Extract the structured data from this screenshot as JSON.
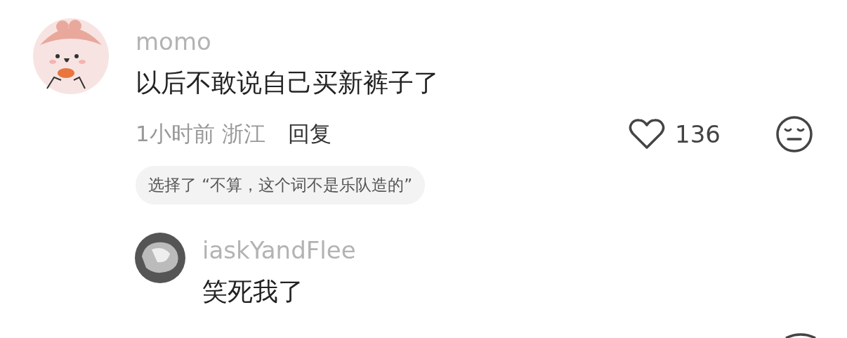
{
  "comment": {
    "username": "momo",
    "text": "以后不敢说自己买新裤子了",
    "time_location": "1小时前 浙江",
    "reply_label": "回复",
    "liked": false,
    "like_count": "136",
    "vote_tag": "选择了 “不算，这个词不是乐队造的”"
  },
  "replies": [
    {
      "username": "iaskYandFlee",
      "text": "笑死我了"
    }
  ]
}
